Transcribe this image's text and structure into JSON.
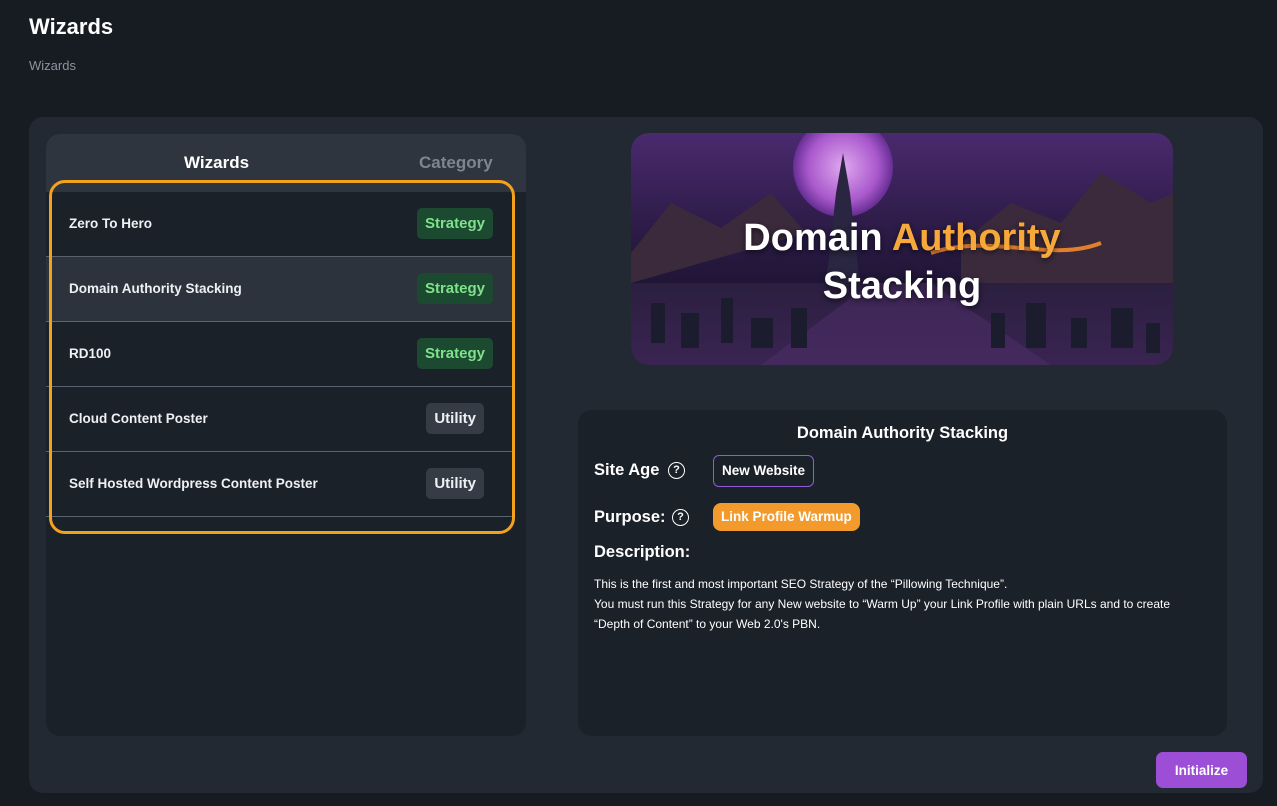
{
  "page": {
    "title": "Wizards",
    "breadcrumb": "Wizards"
  },
  "list": {
    "headers": {
      "name": "Wizards",
      "category": "Category"
    },
    "rows": [
      {
        "name": "Zero To Hero",
        "category": "Strategy"
      },
      {
        "name": "Domain Authority Stacking",
        "category": "Strategy"
      },
      {
        "name": "RD100",
        "category": "Strategy"
      },
      {
        "name": "Cloud Content Poster",
        "category": "Utility"
      },
      {
        "name": "Self Hosted Wordpress Content Poster",
        "category": "Utility"
      }
    ],
    "selected_row": "Domain Authority Stacking"
  },
  "banner": {
    "line1_prefix": "Domain",
    "line1_accent": "Authority",
    "line2": "Stacking"
  },
  "detail": {
    "title": "Domain Authority Stacking",
    "site_age_label": "Site Age",
    "site_age_value": "New Website",
    "purpose_label": "Purpose:",
    "purpose_value": "Link Profile Warmup",
    "description_label": "Description:",
    "description_lines": [
      "This is the first and most important SEO Strategy of the “Pillowing Technique”.",
      "You must run this Strategy for any New website to “Warm Up” your Link Profile with plain URLs and to create",
      "“Depth of Content” to your Web 2.0's PBN."
    ],
    "help_icon_glyph": "?"
  },
  "actions": {
    "initialize_label": "Initialize"
  },
  "colors": {
    "strategy_badge_bg": "#1c4a31",
    "strategy_badge_text": "#7fe28a",
    "utility_badge_bg": "#353c46",
    "highlight_border": "#f4a11b",
    "accent_orange": "#f39a2c",
    "initialize_button": "#9c4fd6"
  }
}
